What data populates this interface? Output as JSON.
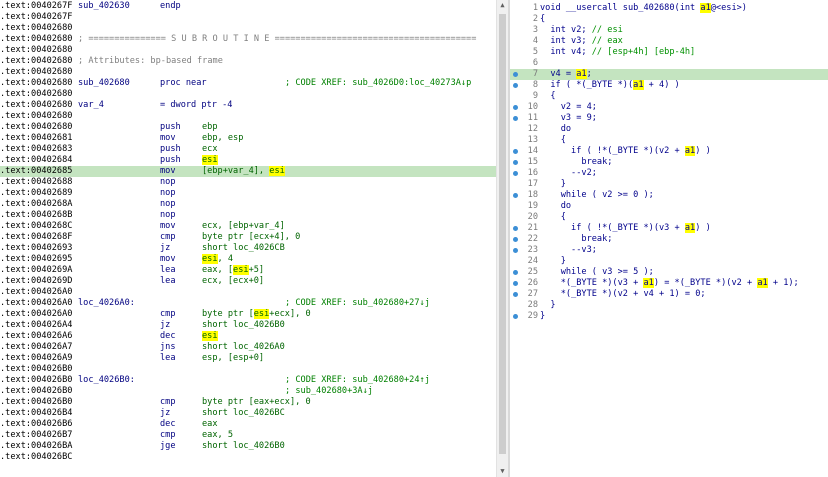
{
  "disasm": {
    "lines": [
      {
        "addr": ".text:0040267F",
        "c1": "sub_402630",
        "c2": "endp",
        "c3": "",
        "cmt": ""
      },
      {
        "addr": ".text:0040267F",
        "c1": "",
        "c2": "",
        "c3": "",
        "cmt": ""
      },
      {
        "addr": ".text:00402680",
        "c1": "",
        "c2": "",
        "c3": "",
        "cmt": ""
      },
      {
        "addr": ".text:00402680",
        "sep": "; =============== S U B R O U T I N E ======================================="
      },
      {
        "addr": ".text:00402680",
        "c1": "",
        "c2": "",
        "c3": "",
        "cmt": ""
      },
      {
        "addr": ".text:00402680",
        "attr": "; Attributes: bp-based frame"
      },
      {
        "addr": ".text:00402680",
        "c1": "",
        "c2": "",
        "c3": "",
        "cmt": ""
      },
      {
        "addr": ".text:00402680",
        "c1": "sub_402680",
        "c2": "proc near",
        "c3": "",
        "cmt": "; CODE XREF: sub_4026D0:loc_40273A↓p"
      },
      {
        "addr": ".text:00402680",
        "c1": "",
        "c2": "",
        "c3": "",
        "cmt": ""
      },
      {
        "addr": ".text:00402680",
        "c1": "var_4",
        "c2": "= dword ptr -4",
        "c3": "",
        "cmt": ""
      },
      {
        "addr": ".text:00402680",
        "c1": "",
        "c2": "",
        "c3": "",
        "cmt": ""
      },
      {
        "addr": ".text:00402680",
        "c1": "",
        "c2": "push",
        "c3": "ebp",
        "cmt": ""
      },
      {
        "addr": ".text:00402681",
        "c1": "",
        "c2": "mov",
        "c3": "ebp, esp",
        "cmt": ""
      },
      {
        "addr": ".text:00402683",
        "c1": "",
        "c2": "push",
        "c3": "ecx",
        "cmt": ""
      },
      {
        "addr": ".text:00402684",
        "c1": "",
        "c2": "push",
        "c3": "esi",
        "cmt": ""
      },
      {
        "addr": ".text:00402685",
        "c1": "",
        "c2": "mov",
        "c3": "[ebp+var_4], esi",
        "cmt": ""
      },
      {
        "addr": ".text:00402688",
        "c1": "",
        "c2": "nop",
        "c3": "",
        "cmt": ""
      },
      {
        "addr": ".text:00402689",
        "c1": "",
        "c2": "nop",
        "c3": "",
        "cmt": ""
      },
      {
        "addr": ".text:0040268A",
        "c1": "",
        "c2": "nop",
        "c3": "",
        "cmt": ""
      },
      {
        "addr": ".text:0040268B",
        "c1": "",
        "c2": "nop",
        "c3": "",
        "cmt": ""
      },
      {
        "addr": ".text:0040268C",
        "c1": "",
        "c2": "mov",
        "c3": "ecx, [ebp+var_4]",
        "cmt": ""
      },
      {
        "addr": ".text:0040268F",
        "c1": "",
        "c2": "cmp",
        "c3": "byte ptr [ecx+4], 0",
        "cmt": ""
      },
      {
        "addr": ".text:00402693",
        "c1": "",
        "c2": "jz",
        "c3": "short loc_4026CB",
        "cmt": ""
      },
      {
        "addr": ".text:00402695",
        "c1": "",
        "c2": "mov",
        "c3": "esi, 4",
        "cmt": ""
      },
      {
        "addr": ".text:0040269A",
        "c1": "",
        "c2": "lea",
        "c3": "eax, [esi+5]",
        "cmt": ""
      },
      {
        "addr": ".text:0040269D",
        "c1": "",
        "c2": "lea",
        "c3": "ecx, [ecx+0]",
        "cmt": ""
      },
      {
        "addr": ".text:004026A0",
        "c1": "",
        "c2": "",
        "c3": "",
        "cmt": ""
      },
      {
        "addr": ".text:004026A0",
        "c1": "loc_4026A0:",
        "c2": "",
        "c3": "",
        "cmt": "; CODE XREF: sub_402680+27↓j"
      },
      {
        "addr": ".text:004026A0",
        "c1": "",
        "c2": "cmp",
        "c3": "byte ptr [esi+ecx], 0",
        "cmt": ""
      },
      {
        "addr": ".text:004026A4",
        "c1": "",
        "c2": "jz",
        "c3": "short loc_4026B0",
        "cmt": ""
      },
      {
        "addr": ".text:004026A6",
        "c1": "",
        "c2": "dec",
        "c3": "esi",
        "cmt": ""
      },
      {
        "addr": ".text:004026A7",
        "c1": "",
        "c2": "jns",
        "c3": "short loc_4026A0",
        "cmt": ""
      },
      {
        "addr": ".text:004026A9",
        "c1": "",
        "c2": "lea",
        "c3": "esp, [esp+0]",
        "cmt": ""
      },
      {
        "addr": ".text:004026B0",
        "c1": "",
        "c2": "",
        "c3": "",
        "cmt": ""
      },
      {
        "addr": ".text:004026B0",
        "c1": "loc_4026B0:",
        "c2": "",
        "c3": "",
        "cmt": "; CODE XREF: sub_402680+24↑j"
      },
      {
        "addr": ".text:004026B0",
        "c1": "",
        "c2": "",
        "c3": "",
        "cmt": "; sub_402680+3A↓j"
      },
      {
        "addr": ".text:004026B0",
        "c1": "",
        "c2": "cmp",
        "c3": "byte ptr [eax+ecx], 0",
        "cmt": ""
      },
      {
        "addr": ".text:004026B4",
        "c1": "",
        "c2": "jz",
        "c3": "short loc_4026BC",
        "cmt": ""
      },
      {
        "addr": ".text:004026B6",
        "c1": "",
        "c2": "dec",
        "c3": "eax",
        "cmt": ""
      },
      {
        "addr": ".text:004026B7",
        "c1": "",
        "c2": "cmp",
        "c3": "eax, 5",
        "cmt": ""
      },
      {
        "addr": ".text:004026BA",
        "c1": "",
        "c2": "jge",
        "c3": "short loc_4026B0",
        "cmt": ""
      },
      {
        "addr": ".text:004026BC",
        "c1": "",
        "c2": "",
        "c3": "",
        "cmt": ""
      }
    ],
    "highlight_index": 15
  },
  "pseudo": {
    "lines": [
      {
        "n": "1",
        "code": "void __usercall sub_402680(int a1@<esi>)"
      },
      {
        "n": "2",
        "code": "{"
      },
      {
        "n": "3",
        "code": "  int v2; // esi"
      },
      {
        "n": "4",
        "code": "  int v3; // eax"
      },
      {
        "n": "5",
        "code": "  int v4; // [esp+4h] [ebp-4h]"
      },
      {
        "n": "6",
        "code": ""
      },
      {
        "n": "7",
        "code": "  v4 = a1;"
      },
      {
        "n": "8",
        "code": "  if ( *(_BYTE *)(a1 + 4) )"
      },
      {
        "n": "9",
        "code": "  {"
      },
      {
        "n": "10",
        "code": "    v2 = 4;"
      },
      {
        "n": "11",
        "code": "    v3 = 9;"
      },
      {
        "n": "12",
        "code": "    do"
      },
      {
        "n": "13",
        "code": "    {"
      },
      {
        "n": "14",
        "code": "      if ( !*(_BYTE *)(v2 + a1) )"
      },
      {
        "n": "15",
        "code": "        break;"
      },
      {
        "n": "16",
        "code": "      --v2;"
      },
      {
        "n": "17",
        "code": "    }"
      },
      {
        "n": "18",
        "code": "    while ( v2 >= 0 );"
      },
      {
        "n": "19",
        "code": "    do"
      },
      {
        "n": "20",
        "code": "    {"
      },
      {
        "n": "21",
        "code": "      if ( !*(_BYTE *)(v3 + a1) )"
      },
      {
        "n": "22",
        "code": "        break;"
      },
      {
        "n": "23",
        "code": "      --v3;"
      },
      {
        "n": "24",
        "code": "    }"
      },
      {
        "n": "25",
        "code": "    while ( v3 >= 5 );"
      },
      {
        "n": "26",
        "code": "    *(_BYTE *)(v3 + a1) = *(_BYTE *)(v2 + a1 + 1);"
      },
      {
        "n": "27",
        "code": "    *(_BYTE *)(v2 + v4 + 1) = 0;"
      },
      {
        "n": "28",
        "code": "  }"
      },
      {
        "n": "29",
        "code": "}"
      }
    ],
    "dot_lines": [
      "7",
      "8",
      "10",
      "11",
      "14",
      "15",
      "16",
      "18",
      "21",
      "22",
      "23",
      "25",
      "26",
      "27",
      "29"
    ],
    "highlight_line": "7",
    "highlight_token": "a1"
  },
  "disasm_highlight_token": "esi",
  "colors": {
    "highlight_row": "#c4e4c0",
    "token_highlight": "#ffff00",
    "keyword": "#000080",
    "comment": "#008000",
    "register": "#006400"
  },
  "icons": {
    "scroll_up": "triangle-up-icon",
    "scroll_down": "triangle-down-icon",
    "breakpoint_dot": "blue-dot-icon"
  }
}
